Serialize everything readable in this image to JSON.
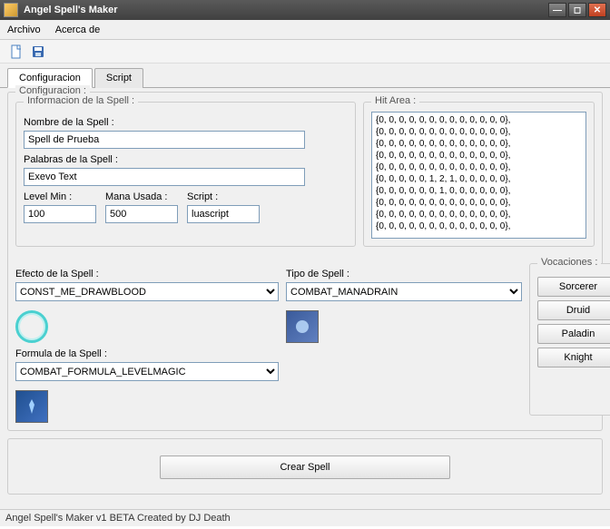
{
  "title": "Angel Spell's Maker",
  "menu": {
    "archivo": "Archivo",
    "acerca": "Acerca de"
  },
  "tabs": {
    "config": "Configuracion",
    "script": "Script"
  },
  "config_legend": "Configuracion :",
  "info_legend": "Informacion de la Spell :",
  "hit_legend": "Hit Area :",
  "labels": {
    "nombre": "Nombre de la Spell :",
    "palabras": "Palabras de la Spell :",
    "levelmin": "Level Min :",
    "mana": "Mana Usada :",
    "script": "Script :",
    "efecto": "Efecto de la Spell :",
    "tipo": "Tipo de Spell :",
    "formula": "Formula de la Spell :",
    "vocaciones": "Vocaciones :"
  },
  "values": {
    "nombre": "Spell de Prueba",
    "palabras": "Exevo Text",
    "levelmin": "100",
    "mana": "500",
    "script": "luascript",
    "efecto": "CONST_ME_DRAWBLOOD",
    "tipo": "COMBAT_MANADRAIN",
    "formula": "COMBAT_FORMULA_LEVELMAGIC"
  },
  "hit_area": [
    "{0, 0, 0, 0, 0, 0, 0, 0, 0, 0, 0, 0, 0},",
    "{0, 0, 0, 0, 0, 0, 0, 0, 0, 0, 0, 0, 0},",
    "{0, 0, 0, 0, 0, 0, 0, 0, 0, 0, 0, 0, 0},",
    "{0, 0, 0, 0, 0, 0, 0, 0, 0, 0, 0, 0, 0},",
    "{0, 0, 0, 0, 0, 0, 0, 0, 0, 0, 0, 0, 0},",
    "{0, 0, 0, 0, 0, 1, 2, 1, 0, 0, 0, 0, 0},",
    "{0, 0, 0, 0, 0, 0, 1, 0, 0, 0, 0, 0, 0},",
    "{0, 0, 0, 0, 0, 0, 0, 0, 0, 0, 0, 0, 0},",
    "{0, 0, 0, 0, 0, 0, 0, 0, 0, 0, 0, 0, 0},",
    "{0, 0, 0, 0, 0, 0, 0, 0, 0, 0, 0, 0, 0},"
  ],
  "vocaciones": [
    "Sorcerer",
    "Druid",
    "Paladin",
    "Knight"
  ],
  "crear": "Crear Spell",
  "status": "Angel Spell's Maker v1 BETA Created by DJ Death"
}
